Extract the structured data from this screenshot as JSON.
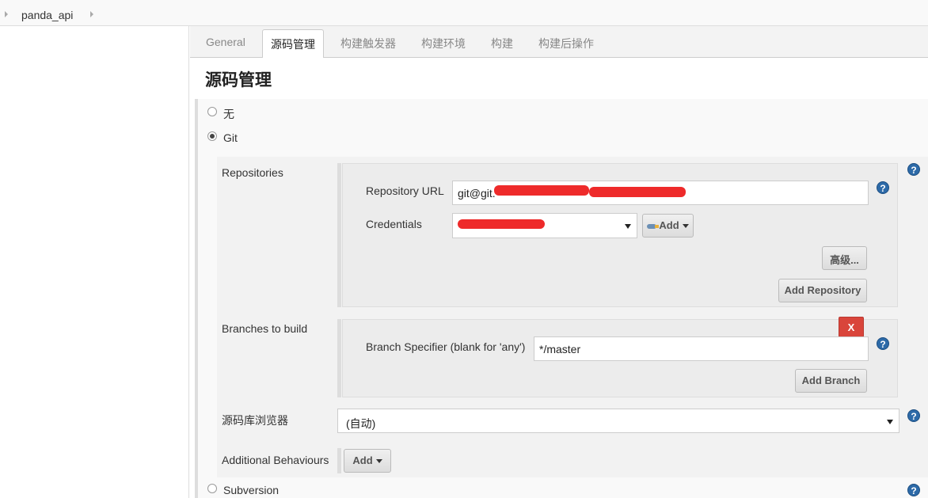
{
  "breadcrumb": {
    "job": "panda_api"
  },
  "tabs": [
    {
      "label": "General"
    },
    {
      "label": "源码管理"
    },
    {
      "label": "构建触发器"
    },
    {
      "label": "构建环境"
    },
    {
      "label": "构建"
    },
    {
      "label": "构建后操作"
    }
  ],
  "active_tab": "源码管理",
  "section_title": "源码管理",
  "scm_options": {
    "none": "无",
    "git": "Git",
    "subversion": "Subversion",
    "selected": "Git"
  },
  "git": {
    "repositories_label": "Repositories",
    "repository_url_label": "Repository URL",
    "repository_url_value": "git@git.",
    "credentials_label": "Credentials",
    "credentials_value": "",
    "credentials_add_label": "Add",
    "advanced_label": "高级...",
    "add_repository_label": "Add Repository",
    "branches_label": "Branches to build",
    "branch_specifier_label": "Branch Specifier (blank for 'any')",
    "branch_specifier_value": "*/master",
    "delete_branch_label": "X",
    "add_branch_label": "Add Branch",
    "browser_label": "源码库浏览器",
    "browser_value": "(自动)",
    "additional_behaviours_label": "Additional Behaviours",
    "additional_add_label": "Add"
  },
  "help_label": "?",
  "colors": {
    "delete": "#d9453b",
    "help": "#2d6aa8",
    "redaction": "#ee2a2a"
  }
}
